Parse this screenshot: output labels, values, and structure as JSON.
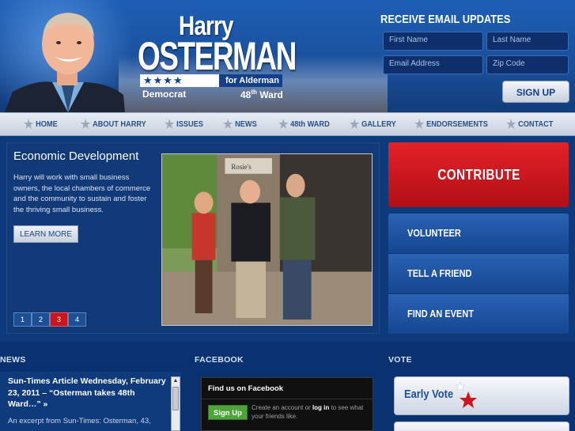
{
  "brand": {
    "first_name": "Harry",
    "last_name": "OSTERMAN",
    "stars": "★★★★",
    "office": "for Alderman",
    "party": "Democrat",
    "ward_num": "48",
    "ward_suffix": "th",
    "ward_word": "Ward"
  },
  "email_signup": {
    "title": "RECEIVE EMAIL UPDATES",
    "first_name_placeholder": "First Name",
    "last_name_placeholder": "Last Name",
    "email_placeholder": "Email Address",
    "zip_placeholder": "Zip Code",
    "button_label": "SIGN UP"
  },
  "nav": {
    "items": [
      {
        "label": "HOME"
      },
      {
        "label": "ABOUT HARRY"
      },
      {
        "label": "ISSUES"
      },
      {
        "label": "NEWS"
      },
      {
        "label": "48th WARD"
      },
      {
        "label": "GALLERY"
      },
      {
        "label": "ENDORSEMENTS"
      },
      {
        "label": "CONTACT"
      }
    ]
  },
  "slider": {
    "title": "Economic Development",
    "text": "Harry will work with small business owners, the local chambers of commerce and the community to sustain and foster the thriving small business.",
    "button_label": "LEARN MORE",
    "photo_sign_text": "Rosie's",
    "pages": [
      "1",
      "2",
      "3",
      "4"
    ],
    "active_page": "3"
  },
  "side": {
    "contribute_label": "CONTRIBUTE",
    "items": [
      {
        "label": "VOLUNTEER"
      },
      {
        "label": "TELL A FRIEND"
      },
      {
        "label": "FIND AN EVENT"
      }
    ]
  },
  "news": {
    "section_title": "NEWS",
    "headline": "Sun-Times Article Wednesday, February 23, 2011 – “Osterman takes 48th Ward…” »",
    "body": "An excerpt from  Sun-Times: Osterman, 43,"
  },
  "facebook": {
    "section_title": "FACEBOOK",
    "box_title": "Find us on Facebook",
    "signup_label": "Sign Up",
    "text_before": "Create an account or ",
    "login_label": "log in",
    "text_after": " to see what your friends like."
  },
  "vote": {
    "section_title": "VOTE",
    "early_vote_label": "Early Vote"
  },
  "colors": {
    "header_blue": "#1a4f9a",
    "accent_red": "#c8161d",
    "nav_text": "#2a4f8a",
    "facebook_green": "#4fa53a"
  }
}
